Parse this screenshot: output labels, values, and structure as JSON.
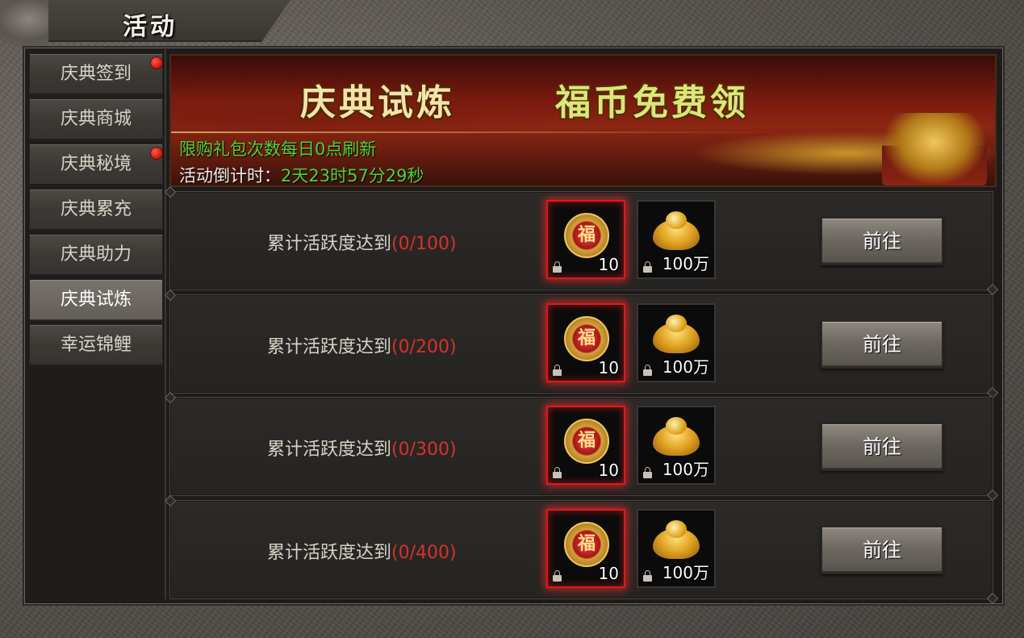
{
  "window": {
    "title": "活动"
  },
  "sidebar": {
    "items": [
      {
        "label": "庆典签到",
        "badge": true,
        "active": false
      },
      {
        "label": "庆典商城",
        "badge": false,
        "active": false
      },
      {
        "label": "庆典秘境",
        "badge": true,
        "active": false
      },
      {
        "label": "庆典累充",
        "badge": false,
        "active": false
      },
      {
        "label": "庆典助力",
        "badge": false,
        "active": false
      },
      {
        "label": "庆典试炼",
        "badge": false,
        "active": true
      },
      {
        "label": "幸运锦鲤",
        "badge": false,
        "active": false
      }
    ]
  },
  "banner": {
    "headline_left": "庆典试炼",
    "headline_right": "福币免费领",
    "notice": "限购礼包次数每日0点刷新",
    "countdown_label": "活动倒计时：",
    "countdown_value": "2天23时57分29秒"
  },
  "tasks": [
    {
      "requirement": "累计活跃度达到",
      "progress": "(0/100)",
      "rewards": [
        {
          "icon": "fu-coin-icon",
          "qty": "10"
        },
        {
          "icon": "gold-ingot-icon",
          "qty": "100万"
        }
      ],
      "button": "前往"
    },
    {
      "requirement": "累计活跃度达到",
      "progress": "(0/200)",
      "rewards": [
        {
          "icon": "fu-coin-icon",
          "qty": "10"
        },
        {
          "icon": "gold-ingot-icon",
          "qty": "100万"
        }
      ],
      "button": "前往"
    },
    {
      "requirement": "累计活跃度达到",
      "progress": "(0/300)",
      "rewards": [
        {
          "icon": "fu-coin-icon",
          "qty": "10"
        },
        {
          "icon": "gold-ingot-icon",
          "qty": "100万"
        }
      ],
      "button": "前往"
    },
    {
      "requirement": "累计活跃度达到",
      "progress": "(0/400)",
      "rewards": [
        {
          "icon": "fu-coin-icon",
          "qty": "10"
        },
        {
          "icon": "gold-ingot-icon",
          "qty": "100万"
        }
      ],
      "button": "前往"
    }
  ],
  "fu_glyph": "福",
  "colors": {
    "progress": "#d7322a",
    "notice": "#4ed23a",
    "accent_gold": "#f0c85a"
  }
}
